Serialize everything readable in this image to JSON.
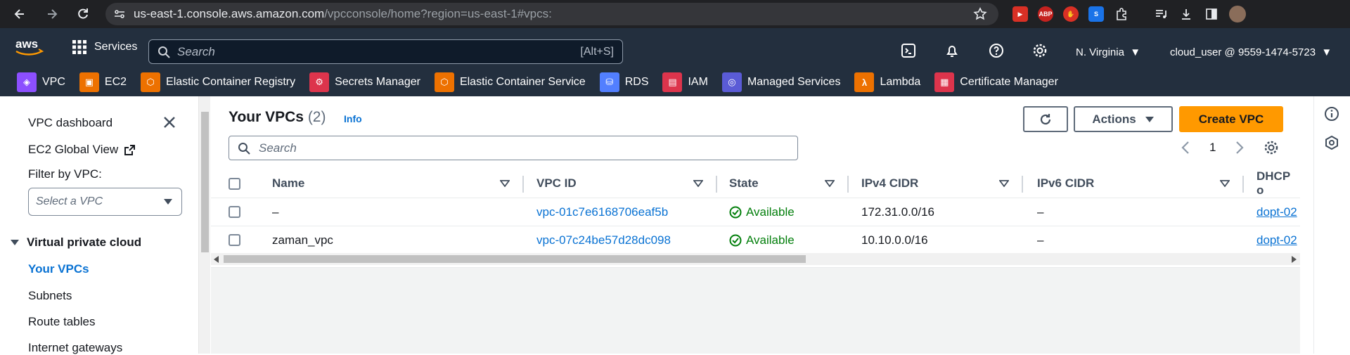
{
  "browser": {
    "url_host": "us-east-1.console.aws.amazon.com",
    "url_path": "/vpcconsole/home?region=us-east-1#vpcs:",
    "extensions": [
      {
        "name": "video-ext-icon",
        "text": "▶",
        "color": "#d93025"
      },
      {
        "name": "abp-icon",
        "text": "ABP",
        "color": "#c5221f"
      },
      {
        "name": "stop-ext-icon",
        "text": "✋",
        "color": "#d93025"
      },
      {
        "name": "s-ext-icon",
        "text": "S",
        "color": "#1a73e8"
      }
    ]
  },
  "aws_nav": {
    "services_label": "Services",
    "search_placeholder": "Search",
    "search_shortcut": "[Alt+S]",
    "region": "N. Virginia",
    "user": "cloud_user @ 9559-1474-5723"
  },
  "favorites": [
    {
      "label": "VPC",
      "color": "#8c4fff",
      "icon": "vpc-icon",
      "glyph": "◈"
    },
    {
      "label": "EC2",
      "color": "#ed7100",
      "icon": "ec2-icon",
      "glyph": "▣"
    },
    {
      "label": "Elastic Container Registry",
      "color": "#ed7100",
      "icon": "ecr-icon",
      "glyph": "⬡"
    },
    {
      "label": "Secrets Manager",
      "color": "#dd344c",
      "icon": "secrets-manager-icon",
      "glyph": "⚙"
    },
    {
      "label": "Elastic Container Service",
      "color": "#ed7100",
      "icon": "ecs-icon",
      "glyph": "⬡"
    },
    {
      "label": "RDS",
      "color": "#527fff",
      "icon": "rds-icon",
      "glyph": "⛁"
    },
    {
      "label": "IAM",
      "color": "#dd344c",
      "icon": "iam-icon",
      "glyph": "▤"
    },
    {
      "label": "Managed Services",
      "color": "#5a5bd6",
      "icon": "managed-services-icon",
      "glyph": "◎"
    },
    {
      "label": "Lambda",
      "color": "#ed7100",
      "icon": "lambda-icon",
      "glyph": "λ"
    },
    {
      "label": "Certificate Manager",
      "color": "#dd344c",
      "icon": "certificate-manager-icon",
      "glyph": "▦"
    }
  ],
  "sidebar": {
    "dashboard": "VPC dashboard",
    "ec2_global": "EC2 Global View",
    "filter_label": "Filter by VPC:",
    "filter_placeholder": "Select a VPC",
    "section": "Virtual private cloud",
    "items": [
      "Your VPCs",
      "Subnets",
      "Route tables",
      "Internet gateways"
    ]
  },
  "main": {
    "title": "Your VPCs",
    "count": "(2)",
    "info": "Info",
    "actions_label": "Actions",
    "create_label": "Create VPC",
    "search_placeholder": "Search",
    "page": "1",
    "columns": [
      "Name",
      "VPC ID",
      "State",
      "IPv4 CIDR",
      "IPv6 CIDR",
      "DHCP o"
    ],
    "rows": [
      {
        "name": "–",
        "vpc_id": "vpc-01c7e6168706eaf5b",
        "state": "Available",
        "ipv4": "172.31.0.0/16",
        "ipv6": "–",
        "dhcp": "dopt-02"
      },
      {
        "name": "zaman_vpc",
        "vpc_id": "vpc-07c24be57d28dc098",
        "state": "Available",
        "ipv4": "10.10.0.0/16",
        "ipv6": "–",
        "dhcp": "dopt-02"
      }
    ]
  },
  "colors": {
    "aws_nav": "#232f3e",
    "link": "#0972d3",
    "primary": "#ff9900",
    "success": "#037f0c"
  }
}
